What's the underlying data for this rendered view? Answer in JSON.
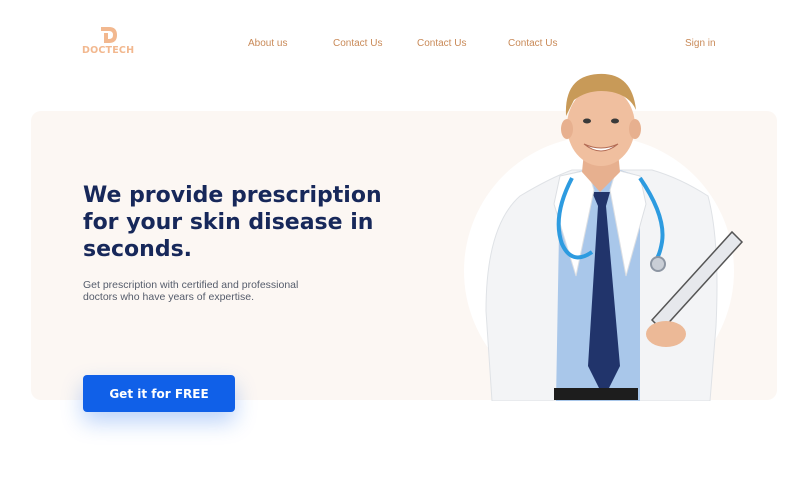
{
  "brand": {
    "name": "DOCTECH",
    "accent": "#f2b88f"
  },
  "nav": {
    "items": [
      {
        "label": "About us"
      },
      {
        "label": "Contact Us"
      },
      {
        "label": "Contact Us"
      },
      {
        "label": "Contact Us"
      }
    ],
    "sign_in": "Sign in"
  },
  "hero": {
    "headline": "We provide prescription for your skin disease in seconds.",
    "subtext": "Get prescription with certified and professional doctors who have years of expertise.",
    "cta_label": "Get it for FREE",
    "image_icon": "doctor-portrait"
  },
  "colors": {
    "headline": "#17285a",
    "cta": "#1060e8",
    "nav_text": "#c98a58",
    "hero_bg": "#fcf7f3"
  }
}
